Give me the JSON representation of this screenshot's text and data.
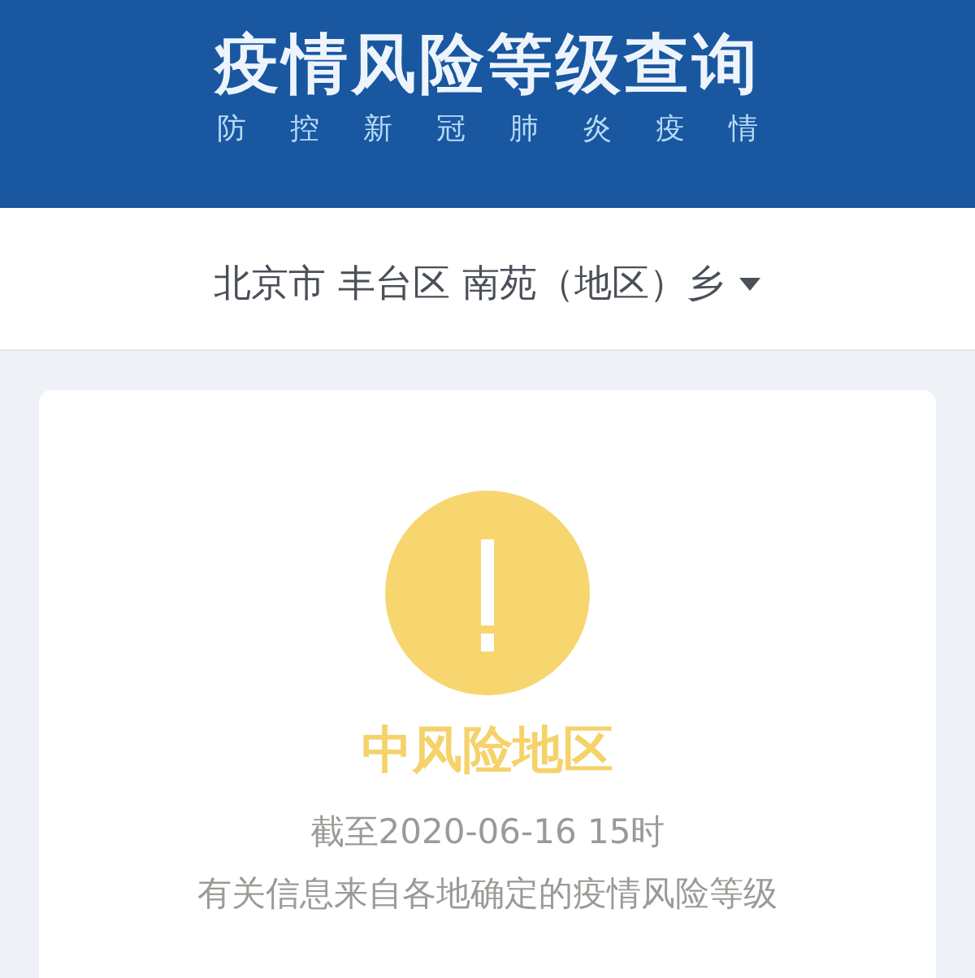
{
  "header": {
    "title": "疫情风险等级查询",
    "subtitle": "防控新冠肺炎疫情"
  },
  "region_picker": {
    "value": "北京市 丰台区 南苑（地区）乡"
  },
  "risk": {
    "kind": "medium",
    "label": "中风险地区"
  },
  "notes": [
    "截至2020-06-16 15时",
    "有关信息来自各地确定的疫情风险等级"
  ]
}
